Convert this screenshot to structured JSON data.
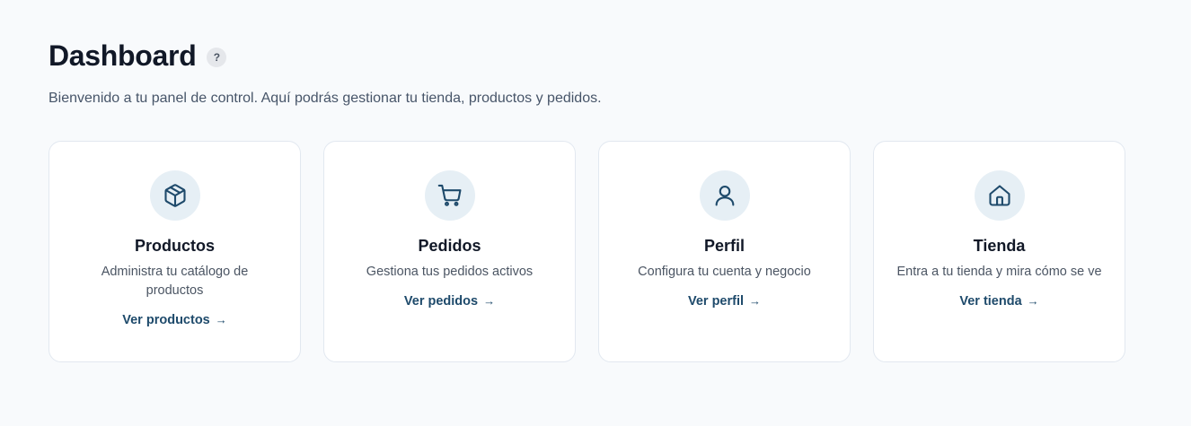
{
  "header": {
    "title": "Dashboard",
    "help_label": "?",
    "subtitle": "Bienvenido a tu panel de control. Aquí podrás gestionar tu tienda, productos y pedidos."
  },
  "cards": [
    {
      "icon": "box-icon",
      "title": "Productos",
      "description": "Administra tu catálogo de productos",
      "link_label": "Ver productos",
      "arrow": "→"
    },
    {
      "icon": "cart-icon",
      "title": "Pedidos",
      "description": "Gestiona tus pedidos activos",
      "link_label": "Ver pedidos",
      "arrow": "→"
    },
    {
      "icon": "user-icon",
      "title": "Perfil",
      "description": "Configura tu cuenta y negocio",
      "link_label": "Ver perfil",
      "arrow": "→"
    },
    {
      "icon": "home-icon",
      "title": "Tienda",
      "description": "Entra a tu tienda y mira cómo se ve",
      "link_label": "Ver tienda",
      "arrow": "→"
    }
  ],
  "colors": {
    "background": "#f8fafc",
    "accent": "#1e4a6b",
    "icon_bg": "#e6eff5"
  }
}
